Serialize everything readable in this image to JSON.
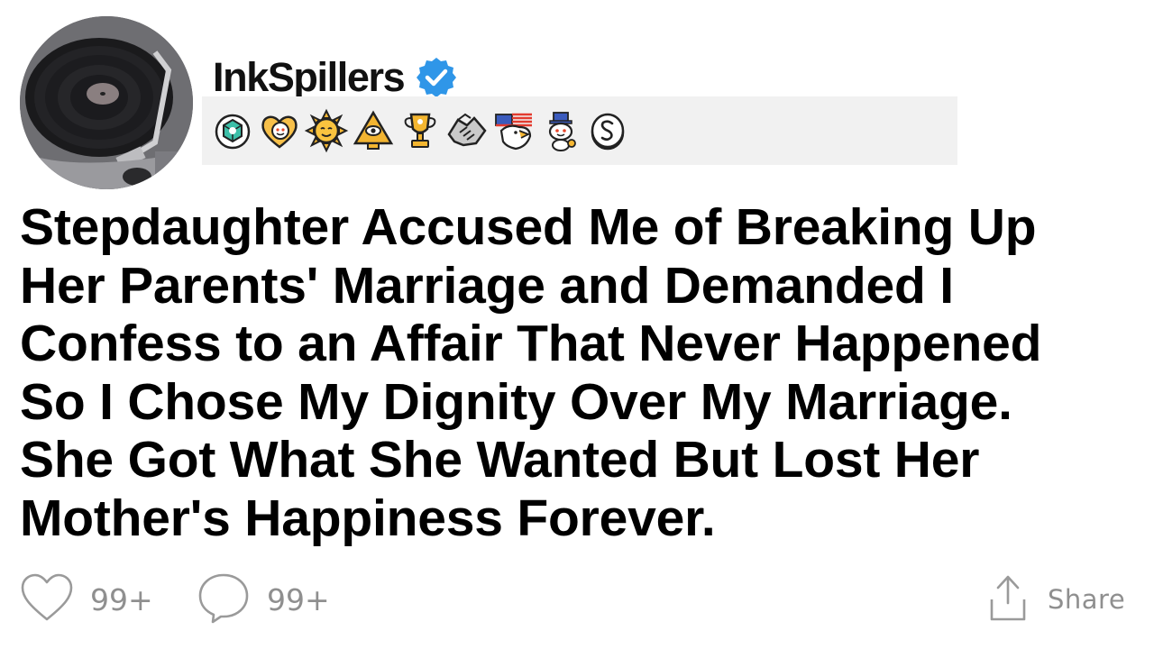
{
  "post": {
    "username": "InkSpillers",
    "verified": true,
    "title_lines": [
      "Stepdaughter Accused Me of Breaking Up",
      "Her Parents' Marriage and Demanded I",
      "Confess to an Affair That Never Happened",
      "So I Chose My Dignity Over My Marriage.",
      "She Got What She Wanted But Lost Her",
      "Mother's Happiness Forever."
    ]
  },
  "awards": [
    {
      "icon": "gem-award-icon"
    },
    {
      "icon": "wholesome-heart-award-icon"
    },
    {
      "icon": "sun-face-award-icon"
    },
    {
      "icon": "pyramid-eye-award-icon"
    },
    {
      "icon": "trophy-award-icon"
    },
    {
      "icon": "handshake-award-icon"
    },
    {
      "icon": "eagle-flag-award-icon"
    },
    {
      "icon": "snoo-hat-award-icon"
    },
    {
      "icon": "silver-coin-award-icon"
    }
  ],
  "actions": {
    "likes": "99+",
    "comments": "99+",
    "share_label": "Share"
  },
  "colors": {
    "verified_blue": "#2f96e8",
    "action_gray": "#8f8f8f",
    "award_bar": "#f1f1f1"
  }
}
